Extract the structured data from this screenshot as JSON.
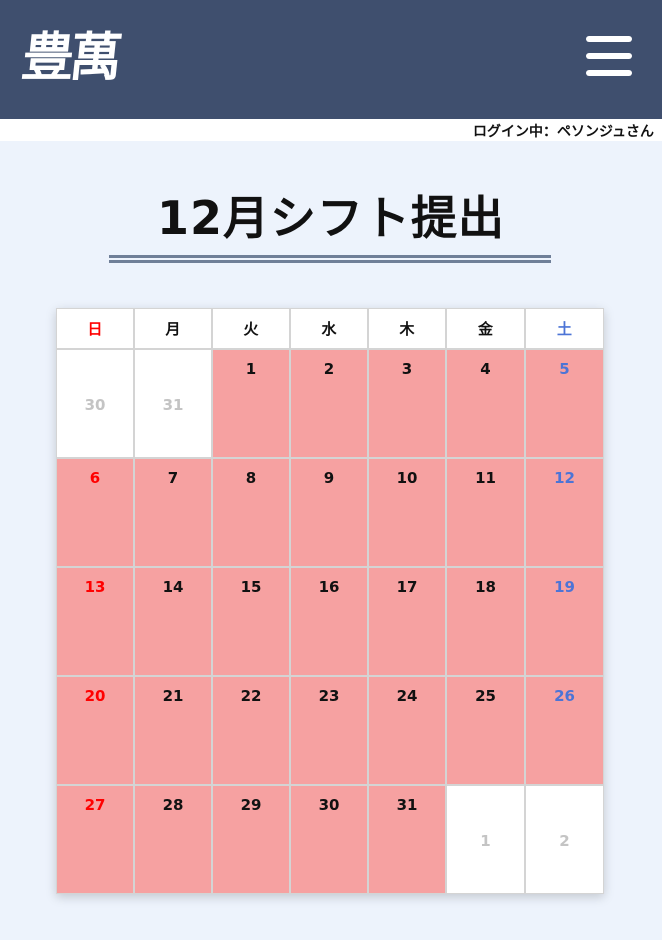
{
  "header": {
    "logo_text": "豊萬",
    "menu_icon": "hamburger-menu-icon"
  },
  "login": {
    "status_text": "ログイン中：ペソンジュさん"
  },
  "page": {
    "title": "12月シフト提出"
  },
  "colors": {
    "header_bg": "#3f4f6e",
    "page_bg": "#edf3fc",
    "shift_cell": "#f6a1a1",
    "sunday": "#ff0000",
    "saturday": "#4c74d6",
    "outside_month_text": "#c4c4c4"
  },
  "calendar": {
    "weekdays": [
      "日",
      "月",
      "火",
      "水",
      "木",
      "金",
      "土"
    ],
    "weeks": [
      [
        {
          "day": "30",
          "in_month": false
        },
        {
          "day": "31",
          "in_month": false
        },
        {
          "day": "1",
          "in_month": true
        },
        {
          "day": "2",
          "in_month": true
        },
        {
          "day": "3",
          "in_month": true
        },
        {
          "day": "4",
          "in_month": true
        },
        {
          "day": "5",
          "in_month": true
        }
      ],
      [
        {
          "day": "6",
          "in_month": true
        },
        {
          "day": "7",
          "in_month": true
        },
        {
          "day": "8",
          "in_month": true
        },
        {
          "day": "9",
          "in_month": true
        },
        {
          "day": "10",
          "in_month": true
        },
        {
          "day": "11",
          "in_month": true
        },
        {
          "day": "12",
          "in_month": true
        }
      ],
      [
        {
          "day": "13",
          "in_month": true
        },
        {
          "day": "14",
          "in_month": true
        },
        {
          "day": "15",
          "in_month": true
        },
        {
          "day": "16",
          "in_month": true
        },
        {
          "day": "17",
          "in_month": true
        },
        {
          "day": "18",
          "in_month": true
        },
        {
          "day": "19",
          "in_month": true
        }
      ],
      [
        {
          "day": "20",
          "in_month": true
        },
        {
          "day": "21",
          "in_month": true
        },
        {
          "day": "22",
          "in_month": true
        },
        {
          "day": "23",
          "in_month": true
        },
        {
          "day": "24",
          "in_month": true
        },
        {
          "day": "25",
          "in_month": true
        },
        {
          "day": "26",
          "in_month": true
        }
      ],
      [
        {
          "day": "27",
          "in_month": true
        },
        {
          "day": "28",
          "in_month": true
        },
        {
          "day": "29",
          "in_month": true
        },
        {
          "day": "30",
          "in_month": true
        },
        {
          "day": "31",
          "in_month": true
        },
        {
          "day": "1",
          "in_month": false
        },
        {
          "day": "2",
          "in_month": false
        }
      ]
    ]
  }
}
